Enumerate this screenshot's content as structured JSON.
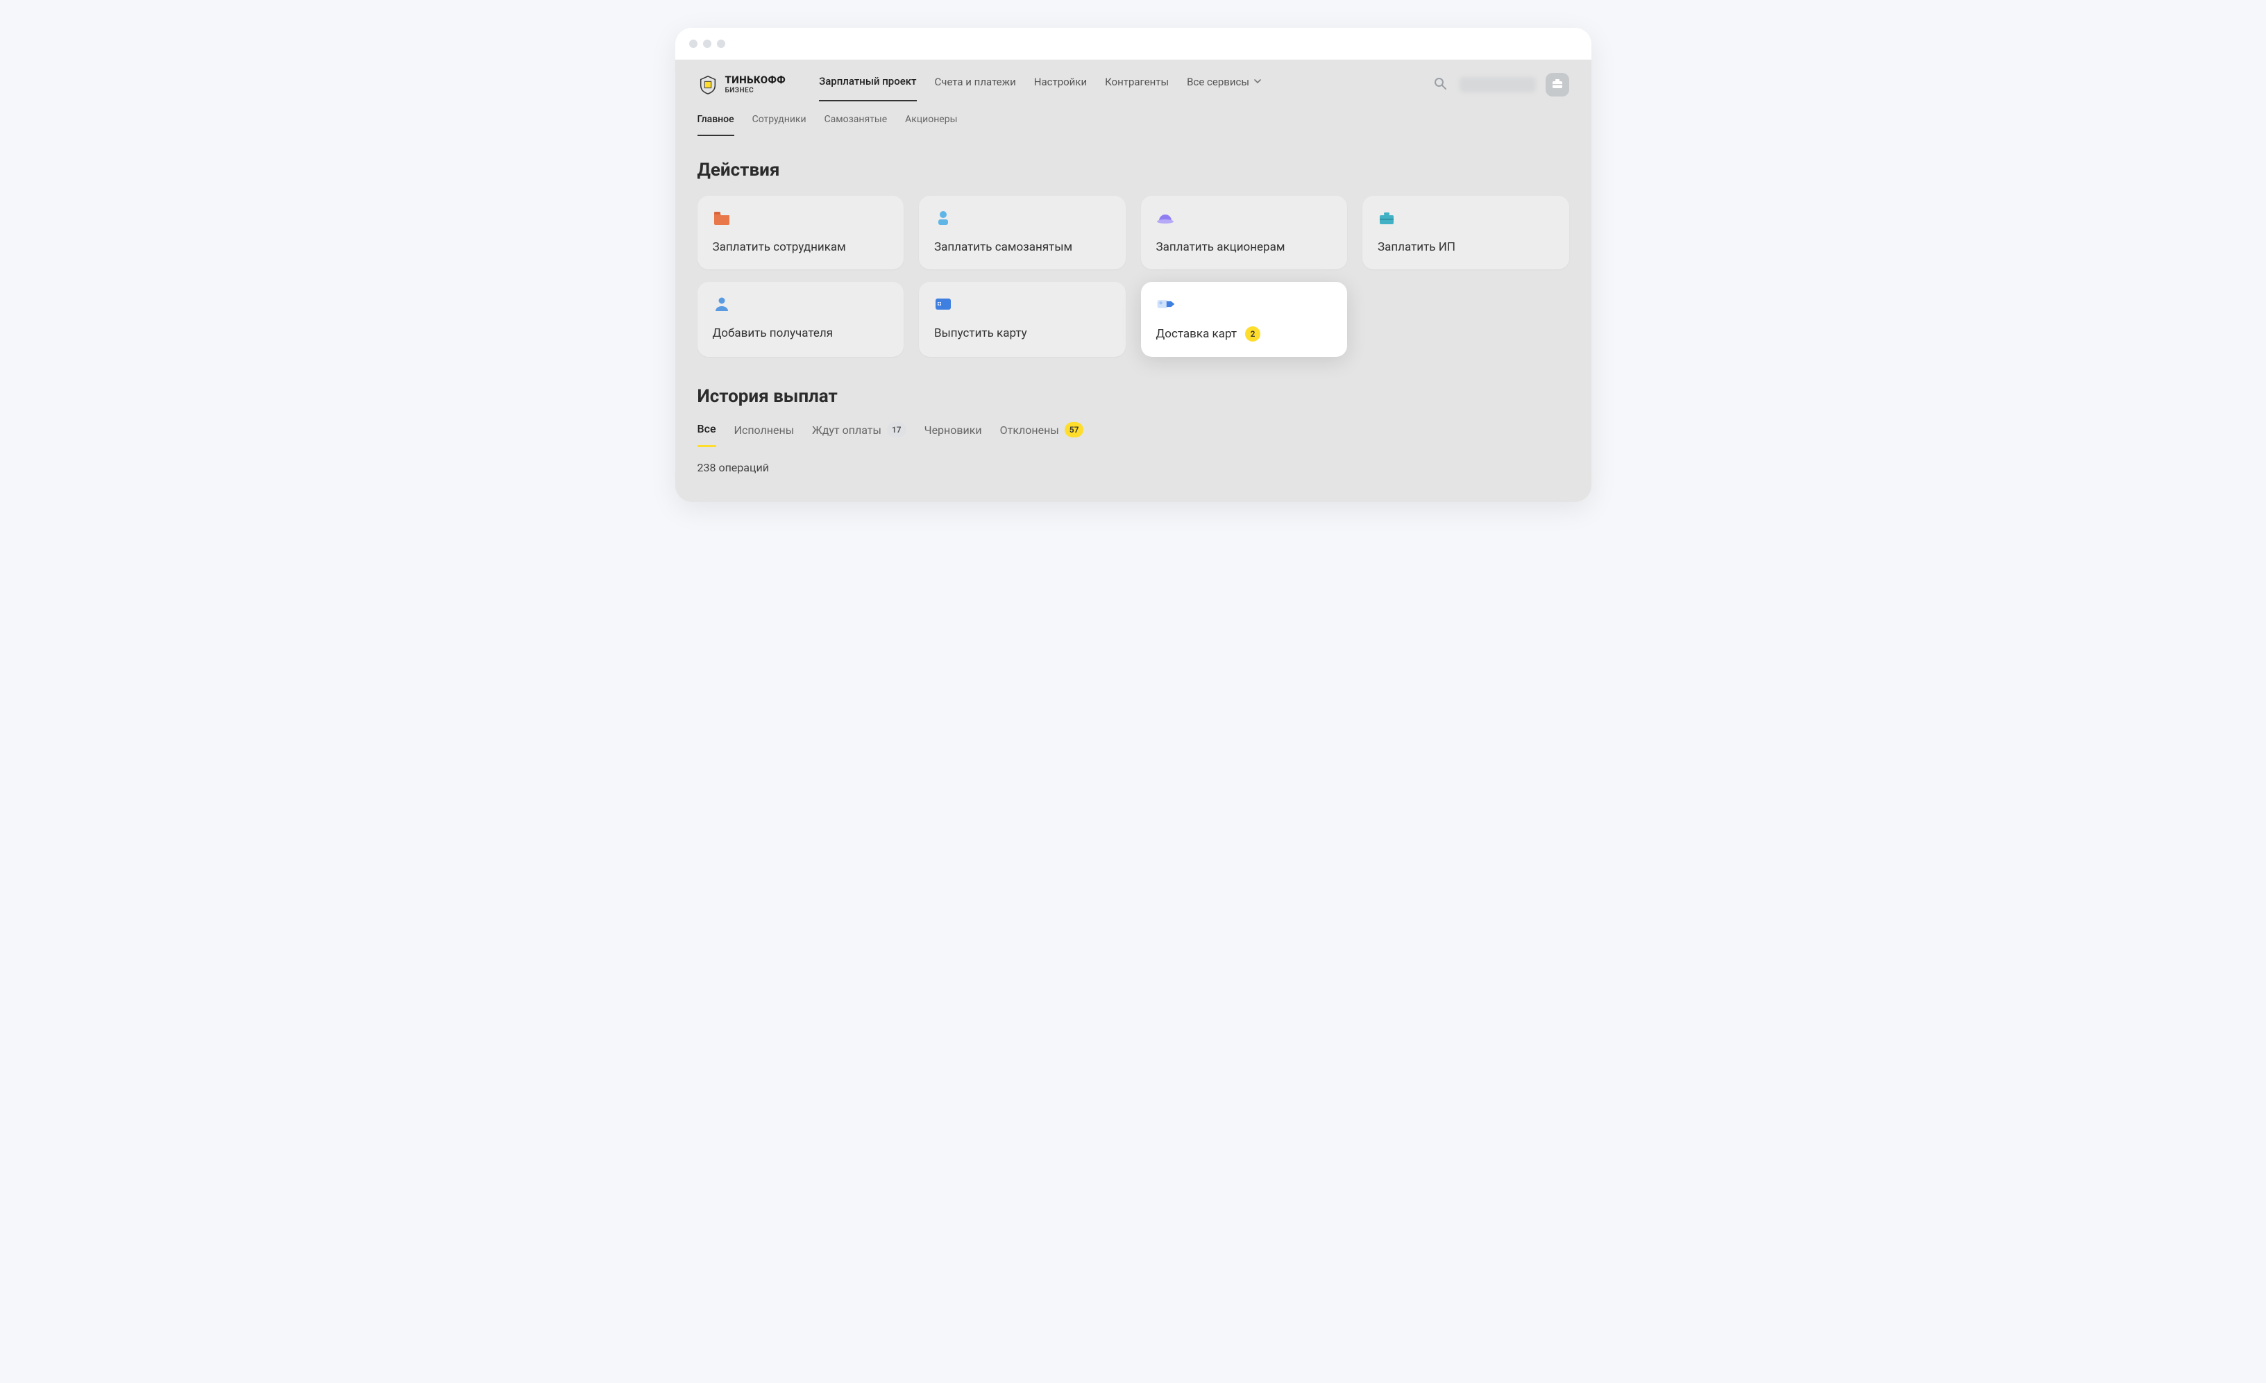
{
  "brand": {
    "line1": "ТИНЬКОФФ",
    "line2": "БИЗНЕС"
  },
  "primary_nav": {
    "items": [
      {
        "label": "Зарплатный проект",
        "active": true
      },
      {
        "label": "Счета и платежи"
      },
      {
        "label": "Настройки"
      },
      {
        "label": "Контрагенты"
      },
      {
        "label": "Все сервисы",
        "dropdown": true
      }
    ]
  },
  "secondary_nav": {
    "items": [
      {
        "label": "Главное",
        "active": true
      },
      {
        "label": "Сотрудники"
      },
      {
        "label": "Самозанятые"
      },
      {
        "label": "Акционеры"
      }
    ]
  },
  "sections": {
    "actions_title": "Действия",
    "history_title": "История выплат"
  },
  "actions": [
    {
      "label": "Заплатить сотрудникам",
      "icon": "folder",
      "icon_color": "#e8774a"
    },
    {
      "label": "Заплатить самозанятым",
      "icon": "person-badge",
      "icon_color": "#5fb5e6"
    },
    {
      "label": "Заплатить акционерам",
      "icon": "helmet",
      "icon_color": "#8f7df2"
    },
    {
      "label": "Заплатить ИП",
      "icon": "briefcase",
      "icon_color": "#41b2c5"
    },
    {
      "label": "Добавить получателя",
      "icon": "person",
      "icon_color": "#5a9ae0"
    },
    {
      "label": "Выпустить карту",
      "icon": "card-plus",
      "icon_color": "#3f7fe0"
    },
    {
      "label": "Доставка карт",
      "icon": "card-arrow",
      "icon_color": "#3f7fe0",
      "badge": "2",
      "highlight": true
    }
  ],
  "history_tabs": [
    {
      "label": "Все",
      "active": true
    },
    {
      "label": "Исполнены"
    },
    {
      "label": "Ждут оплаты",
      "badge": "17",
      "badge_style": "gray"
    },
    {
      "label": "Черновики"
    },
    {
      "label": "Отклонены",
      "badge": "57",
      "badge_style": "yellow"
    }
  ],
  "history_summary": "238 операций"
}
